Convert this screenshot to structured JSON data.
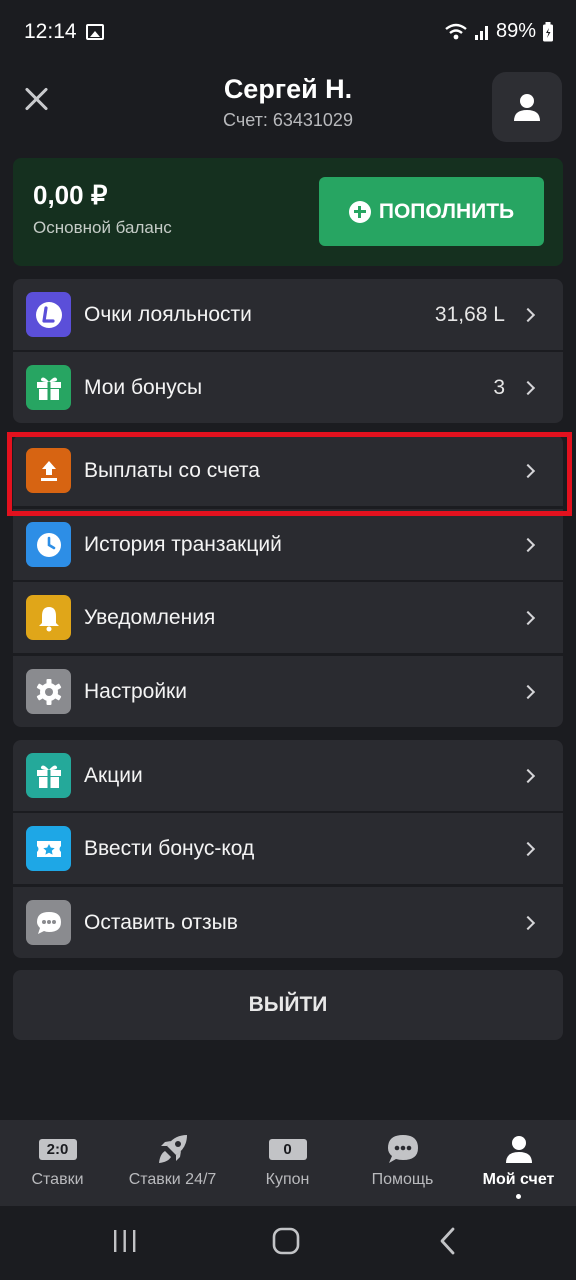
{
  "status_bar": {
    "time": "12:14",
    "battery": "89%"
  },
  "header": {
    "name": "Сергей Н.",
    "account": "Счет: 63431029"
  },
  "balance": {
    "amount": "0,00 ₽",
    "label": "Основной баланс",
    "topup": "ПОПОЛНИТЬ"
  },
  "group1": [
    {
      "label": "Очки лояльности",
      "value": "31,68 L",
      "icon": "loyalty-l-icon",
      "color": "#5b4fd9"
    },
    {
      "label": "Мои бонусы",
      "value": "3",
      "icon": "gift-icon",
      "color": "#27a562"
    }
  ],
  "group2": [
    {
      "label": "Выплаты со счета",
      "icon": "upload-icon",
      "color": "#d76412"
    },
    {
      "label": "История транзакций",
      "icon": "clock-icon",
      "color": "#2d8ee6"
    },
    {
      "label": "Уведомления",
      "icon": "bell-icon",
      "color": "#e0a619"
    },
    {
      "label": "Настройки",
      "icon": "gear-icon",
      "color": "#8a8b8f"
    }
  ],
  "group3": [
    {
      "label": "Акции",
      "icon": "gift-icon",
      "color": "#24a99a"
    },
    {
      "label": "Ввести бонус-код",
      "icon": "ticket-star-icon",
      "color": "#1ea7e6"
    },
    {
      "label": "Оставить отзыв",
      "icon": "chat-bubble-icon",
      "color": "#8a8b8f"
    }
  ],
  "logout": "ВЫЙТИ",
  "tabs": [
    {
      "label": "Ставки",
      "badge": "2:0",
      "icon": "score-icon"
    },
    {
      "label": "Ставки 24/7",
      "icon": "rocket-icon"
    },
    {
      "label": "Купон",
      "badge": "0",
      "icon": "coupon-icon"
    },
    {
      "label": "Помощь",
      "icon": "help-chat-icon"
    },
    {
      "label": "Мой счет",
      "icon": "user-icon",
      "active": true
    }
  ]
}
